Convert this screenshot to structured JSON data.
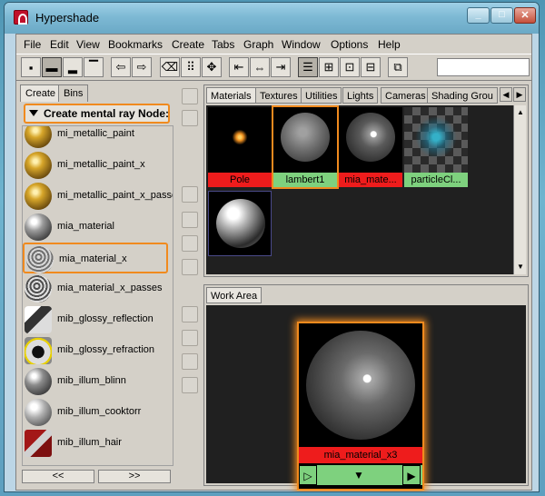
{
  "window": {
    "title": "Hypershade"
  },
  "menu": [
    "File",
    "Edit",
    "View",
    "Bookmarks",
    "Create",
    "Tabs",
    "Graph",
    "Window",
    "Options",
    "Help"
  ],
  "left_panel": {
    "tabs": [
      "Create",
      "Bins"
    ],
    "header": "Create mental ray Node:",
    "nodes": [
      "mi_metallic_paint",
      "mi_metallic_paint_x",
      "mi_metallic_paint_x_passes",
      "mia_material",
      "mia_material_x",
      "mia_material_x_passes",
      "mib_glossy_reflection",
      "mib_glossy_refraction",
      "mib_illum_blinn",
      "mib_illum_cooktorr",
      "mib_illum_hair"
    ],
    "nav": [
      "<<",
      ">>"
    ]
  },
  "top_tabs": [
    "Materials",
    "Textures",
    "Utilities",
    "Lights",
    "Cameras",
    "Shading Grou"
  ],
  "thumbnails": [
    {
      "label": "Pole",
      "caption_color": "#ee1c1c"
    },
    {
      "label": "lambert1",
      "caption_color": "#7ed17e"
    },
    {
      "label": "mia_mate...",
      "caption_color": "#ee1c1c"
    },
    {
      "label": "particleCl...",
      "caption_color": "#7ed17e"
    },
    {
      "label": "",
      "caption_color": ""
    }
  ],
  "work_area": {
    "tab": "Work Area",
    "node_label": "mia_material_x3",
    "controls": [
      "▷",
      "▼",
      "▶"
    ]
  },
  "colors": {
    "highlight": "#f08a1e",
    "error_red": "#ee1c1c",
    "ok_green": "#7ed17e"
  }
}
